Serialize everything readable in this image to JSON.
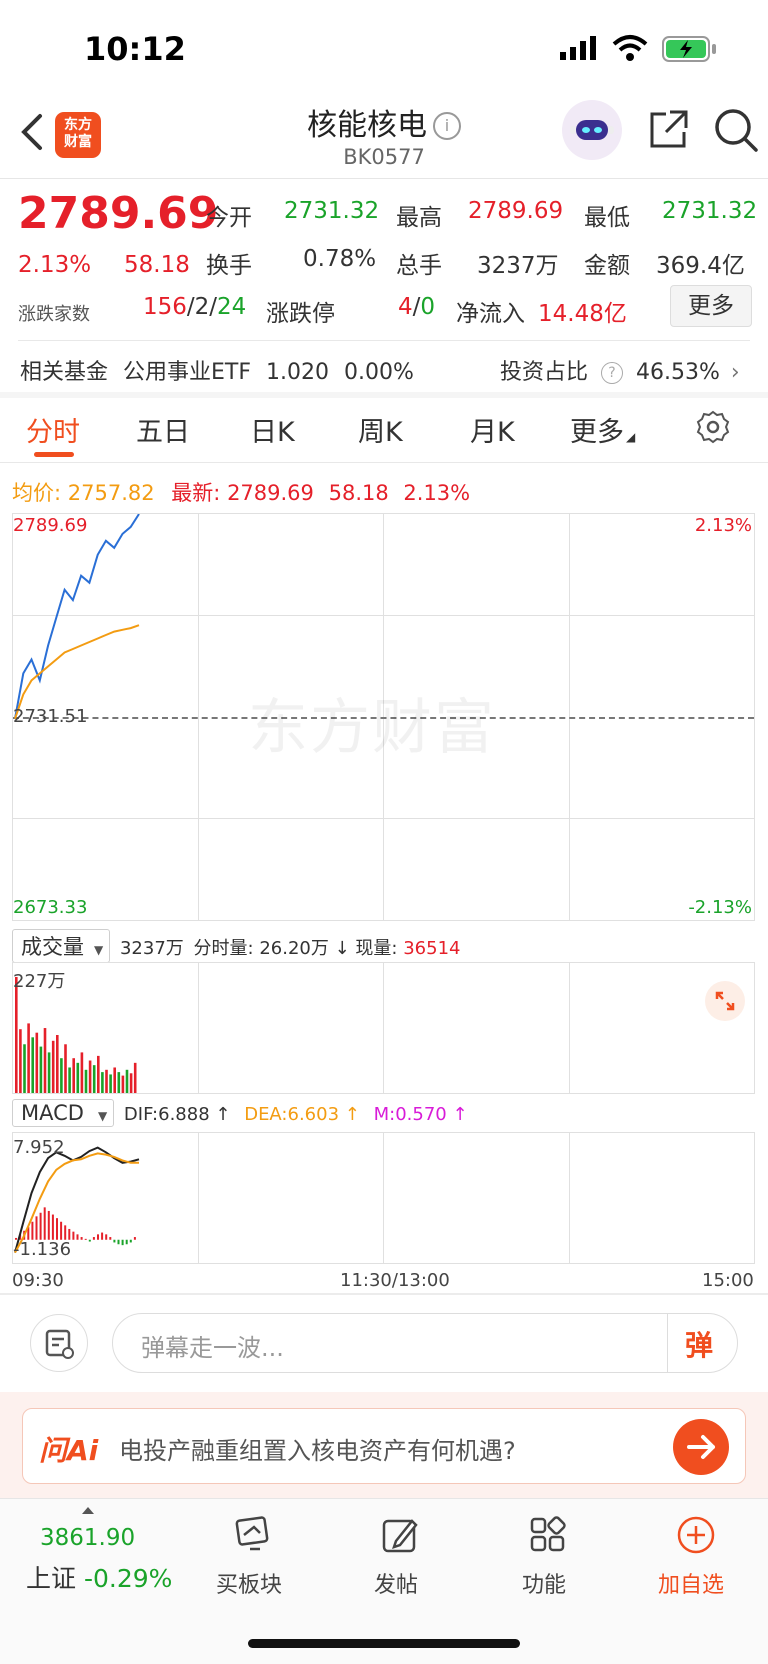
{
  "status_bar": {
    "time": "10:12"
  },
  "header": {
    "title": "核能核电",
    "code": "BK0577",
    "logo_text": "东方财富"
  },
  "quote": {
    "price": "2789.69",
    "pct": "2.13%",
    "change": "58.18",
    "rise_fall_label": "涨跌家数",
    "rise": "156",
    "flat": "2",
    "fall": "24",
    "open_label": "今开",
    "open": "2731.32",
    "high_label": "最高",
    "high": "2789.69",
    "low_label": "最低",
    "low": "2731.32",
    "turnover_label": "换手",
    "turnover": "0.78%",
    "volume_label": "总手",
    "volume": "3237万",
    "amount_label": "金额",
    "amount": "369.4亿",
    "limit_label": "涨跌停",
    "limit_up": "4",
    "limit_down": "0",
    "inflow_label": "净流入",
    "inflow": "14.48亿",
    "more_button": "更多"
  },
  "fund": {
    "label": "相关基金",
    "name": "公用事业ETF",
    "price": "1.020",
    "pct": "0.00%",
    "ratio_label": "投资占比",
    "ratio": "46.53%"
  },
  "tabs": [
    "分时",
    "五日",
    "日K",
    "周K",
    "月K",
    "更多"
  ],
  "avg_line": {
    "avg_label": "均价:",
    "avg": "2757.82",
    "latest_label": "最新:",
    "latest": "2789.69",
    "change": "58.18",
    "pct": "2.13%"
  },
  "chart_data": {
    "type": "line",
    "title": "",
    "y_left_ticks": [
      "2789.69",
      "2731.51",
      "2673.33"
    ],
    "y_right_ticks": [
      "2.13%",
      "",
      "-2.13%"
    ],
    "ylim": [
      2673.33,
      2789.69
    ],
    "baseline": 2731.51,
    "x_ticks": [
      "09:30",
      "11:30/13:00",
      "15:00"
    ],
    "watermark": "东方财富",
    "series": [
      {
        "name": "最新",
        "color": "#2a6fd6",
        "values": [
          2731,
          2744,
          2748,
          2742,
          2752,
          2760,
          2768,
          2765,
          2772,
          2770,
          2778,
          2782,
          2780,
          2784,
          2786,
          2789.69
        ]
      },
      {
        "name": "均价",
        "color": "#f39c12",
        "values": [
          2731,
          2738,
          2742,
          2744,
          2746,
          2748,
          2750,
          2751,
          2752,
          2753,
          2754,
          2755,
          2756,
          2756.5,
          2757,
          2757.82
        ]
      }
    ]
  },
  "volume": {
    "selector": "成交量",
    "total": "3237万",
    "tick_label": "分时量:",
    "tick_value": "26.20万",
    "now_label": "现量:",
    "now_value": "36514",
    "max_tick": "227万",
    "bars": [
      {
        "v": 1.0,
        "c": "red"
      },
      {
        "v": 0.55,
        "c": "red"
      },
      {
        "v": 0.42,
        "c": "green"
      },
      {
        "v": 0.6,
        "c": "red"
      },
      {
        "v": 0.48,
        "c": "green"
      },
      {
        "v": 0.52,
        "c": "red"
      },
      {
        "v": 0.4,
        "c": "green"
      },
      {
        "v": 0.56,
        "c": "red"
      },
      {
        "v": 0.35,
        "c": "green"
      },
      {
        "v": 0.45,
        "c": "red"
      },
      {
        "v": 0.5,
        "c": "red"
      },
      {
        "v": 0.3,
        "c": "green"
      },
      {
        "v": 0.42,
        "c": "red"
      },
      {
        "v": 0.22,
        "c": "green"
      },
      {
        "v": 0.3,
        "c": "red"
      },
      {
        "v": 0.26,
        "c": "green"
      },
      {
        "v": 0.35,
        "c": "red"
      },
      {
        "v": 0.2,
        "c": "green"
      },
      {
        "v": 0.28,
        "c": "red"
      },
      {
        "v": 0.24,
        "c": "green"
      },
      {
        "v": 0.32,
        "c": "red"
      },
      {
        "v": 0.18,
        "c": "green"
      },
      {
        "v": 0.2,
        "c": "red"
      },
      {
        "v": 0.16,
        "c": "green"
      },
      {
        "v": 0.22,
        "c": "red"
      },
      {
        "v": 0.18,
        "c": "green"
      },
      {
        "v": 0.15,
        "c": "red"
      },
      {
        "v": 0.2,
        "c": "green"
      },
      {
        "v": 0.17,
        "c": "red"
      },
      {
        "v": 0.26,
        "c": "red"
      }
    ]
  },
  "macd": {
    "selector": "MACD",
    "dif_label": "DIF:",
    "dif": "6.888 ↑",
    "dea_label": "DEA:",
    "dea": "6.603 ↑",
    "m_label": "M:",
    "m": "0.570 ↑",
    "top_tick": "7.952",
    "bottom_tick": "-1.136",
    "dif_values": [
      -1.1,
      1.5,
      4.0,
      5.8,
      7.0,
      7.5,
      7.2,
      6.8,
      7.1,
      7.6,
      7.9,
      7.5,
      7.0,
      6.6,
      6.7,
      6.9
    ],
    "dea_values": [
      -1.1,
      0.2,
      1.8,
      3.5,
      5.0,
      6.0,
      6.5,
      6.8,
      6.9,
      7.2,
      7.4,
      7.3,
      7.1,
      6.8,
      6.6,
      6.6
    ],
    "hist": [
      0.2,
      0.6,
      1.0,
      1.4,
      2.0,
      2.6,
      3.0,
      3.6,
      3.2,
      2.8,
      2.4,
      2.0,
      1.6,
      1.2,
      0.9,
      0.6,
      0.3,
      0.1,
      -0.2,
      0.3,
      0.6,
      0.8,
      0.6,
      0.3,
      -0.3,
      -0.5,
      -0.6,
      -0.5,
      -0.3,
      0.3
    ]
  },
  "comment_bar": {
    "placeholder": "弹幕走一波...",
    "danmu": "弹"
  },
  "ai": {
    "brand": "问Ai",
    "question": "电投产融重组置入核电资产有何机遇?"
  },
  "bottom_nav": {
    "index_value": "3861.90",
    "index_name": "上证",
    "index_pct": "-0.29%",
    "items": [
      "买板块",
      "发帖",
      "功能",
      "加自选"
    ]
  },
  "colors": {
    "red": "#e5202a",
    "green": "#1aa32a",
    "orange": "#f39c12",
    "blue": "#2a6fd6",
    "accent": "#f04e1f"
  }
}
